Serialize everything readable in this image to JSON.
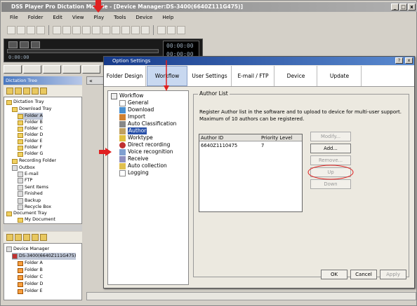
{
  "window": {
    "title": "DSS Player Pro Dictation Module - [Device Manager:DS-3400(6640Z111G475)]",
    "min_label": "_",
    "max_label": "□",
    "close_label": "x"
  },
  "menu": [
    "File",
    "Folder",
    "Edit",
    "View",
    "Play",
    "Tools",
    "Device",
    "Help"
  ],
  "player": {
    "time_left": "0:00:00",
    "time_right1": "00:00:00",
    "time_right2": "00:00:00"
  },
  "left_panel": {
    "header": "Dictation Tree",
    "tree": [
      {
        "label": "Dictation Tray",
        "level": 0
      },
      {
        "label": "Download Tray",
        "level": 1
      },
      {
        "label": "Folder A",
        "level": 2,
        "selected": true
      },
      {
        "label": "Folder B",
        "level": 2
      },
      {
        "label": "Folder C",
        "level": 2
      },
      {
        "label": "Folder D",
        "level": 2
      },
      {
        "label": "Folder E",
        "level": 2
      },
      {
        "label": "Folder F",
        "level": 2
      },
      {
        "label": "Folder G",
        "level": 2
      },
      {
        "label": "Recording Folder",
        "level": 1
      },
      {
        "label": "Outbox",
        "level": 1
      },
      {
        "label": "E-mail",
        "level": 2
      },
      {
        "label": "FTP",
        "level": 2
      },
      {
        "label": "Sent Items",
        "level": 1
      },
      {
        "label": "Finished",
        "level": 1
      },
      {
        "label": "Backup",
        "level": 1
      },
      {
        "label": "Recycle Box",
        "level": 1
      },
      {
        "label": "Document Tray",
        "level": 0
      },
      {
        "label": "My Document",
        "level": 1
      }
    ],
    "device_tree": [
      {
        "label": "Device Manager",
        "level": 0
      },
      {
        "label": "DS-3400(6640Z111G475)",
        "level": 1,
        "selected": true
      },
      {
        "label": "Folder A",
        "level": 2
      },
      {
        "label": "Folder B",
        "level": 2
      },
      {
        "label": "Folder C",
        "level": 2
      },
      {
        "label": "Folder D",
        "level": 2
      },
      {
        "label": "Folder E",
        "level": 2
      }
    ]
  },
  "dialog": {
    "title": "Option Settings",
    "close_label": "x",
    "help_label": "?",
    "tabs": [
      "Folder Design",
      "Workflow",
      "User Settings",
      "E-mail / FTP",
      "Device",
      "Update"
    ],
    "active_tab": "Workflow",
    "nav": [
      {
        "label": "Workflow",
        "level": 0
      },
      {
        "label": "General",
        "level": 1
      },
      {
        "label": "Download",
        "level": 1
      },
      {
        "label": "Import",
        "level": 1
      },
      {
        "label": "Auto Classification",
        "level": 1
      },
      {
        "label": "Author",
        "level": 1,
        "active": true
      },
      {
        "label": "Worktype",
        "level": 1
      },
      {
        "label": "Direct recording",
        "level": 1
      },
      {
        "label": "Voice recognition",
        "level": 1
      },
      {
        "label": "Receive",
        "level": 1
      },
      {
        "label": "Auto collection",
        "level": 1
      },
      {
        "label": "Logging",
        "level": 1
      }
    ],
    "group_label": "Author List",
    "description": "Register Author list in the software and to upload to device for multi-user support. Maximum of 10 authors can be registered.",
    "table": {
      "columns": [
        "Author ID",
        "Priority Level"
      ],
      "rows": [
        [
          "6640Z1110475",
          "7"
        ]
      ]
    },
    "side_buttons": [
      {
        "label": "Modify...",
        "enabled": false
      },
      {
        "label": "Add...",
        "enabled": true
      },
      {
        "label": "Remove...",
        "enabled": false
      },
      {
        "label": "Up",
        "enabled": false
      },
      {
        "label": "Down",
        "enabled": false
      }
    ],
    "ok": "OK",
    "cancel": "Cancel",
    "apply": "Apply"
  },
  "colors": {
    "annotation": "#e02020",
    "dialog_title": "#163a8a",
    "active_tab": "#c8d8f0",
    "selection": "#2850a8"
  }
}
